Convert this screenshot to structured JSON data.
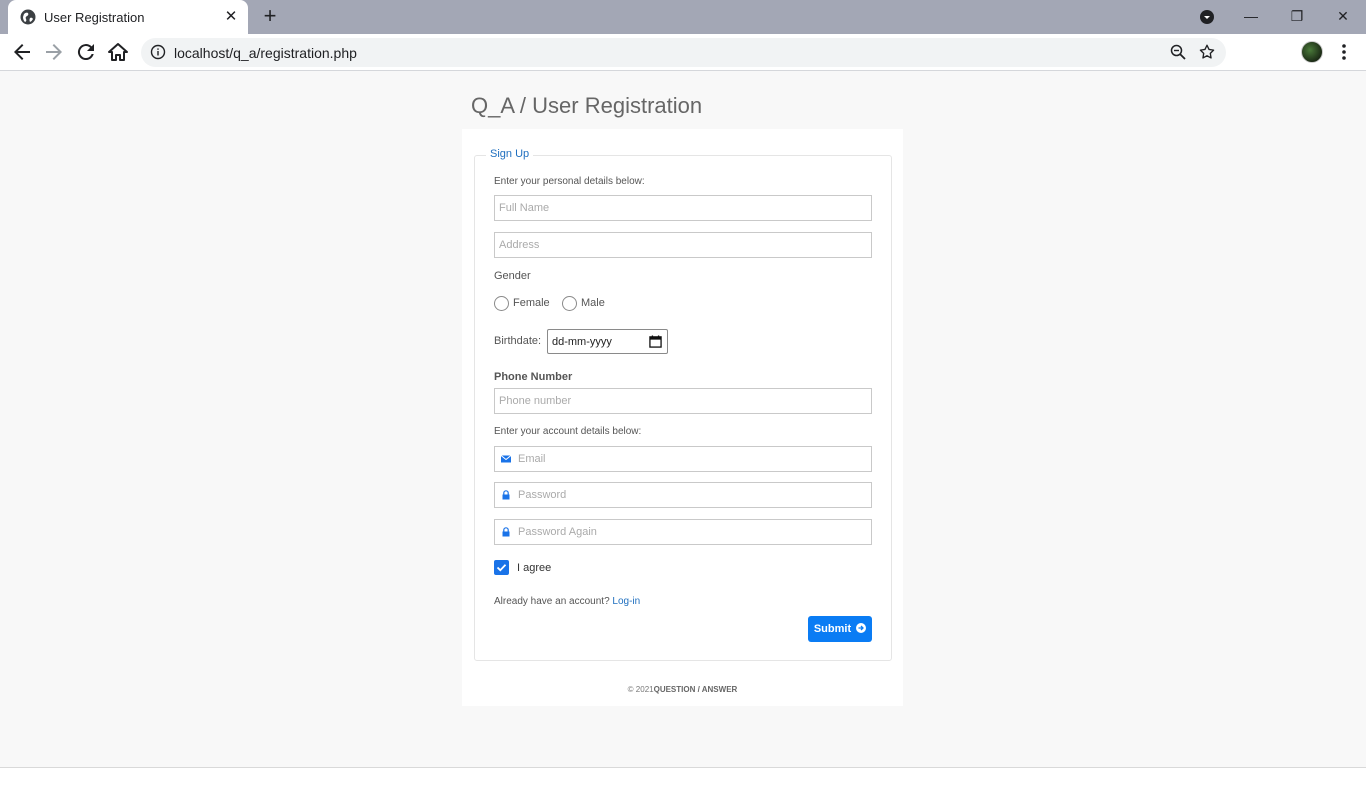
{
  "browser": {
    "tab_title": "User Registration",
    "new_tab_symbol": "+",
    "close_symbol": "✕",
    "window_controls": {
      "minimize": "—",
      "restore": "❐",
      "close": "✕"
    },
    "url": "localhost/q_a/registration.php"
  },
  "page": {
    "title": "Q_A / User Registration",
    "legend": "Sign Up",
    "personal_hint": "Enter your personal details below:",
    "full_name_placeholder": "Full Name",
    "address_placeholder": "Address",
    "gender_label": "Gender",
    "gender_options": [
      "Female",
      "Male"
    ],
    "birthdate_label": "Birthdate:",
    "birthdate_value": "dd-mm-yyyy",
    "phone_label": "Phone Number",
    "phone_placeholder": "Phone number",
    "account_hint": "Enter your account details below:",
    "email_placeholder": "Email",
    "password_placeholder": "Password",
    "password_again_placeholder": "Password Again",
    "agree_label": "I agree",
    "agree_checked": true,
    "already_text": "Already have an account?",
    "login_link": "Log-in",
    "submit_label": "Submit",
    "footer_prefix": "© 2021",
    "footer_brand": "QUESTION / ANSWER"
  },
  "colors": {
    "accent": "#0a7cf4",
    "link": "#1f6fbf",
    "tabbar": "#a3a7b5",
    "shield": "#34a853"
  }
}
